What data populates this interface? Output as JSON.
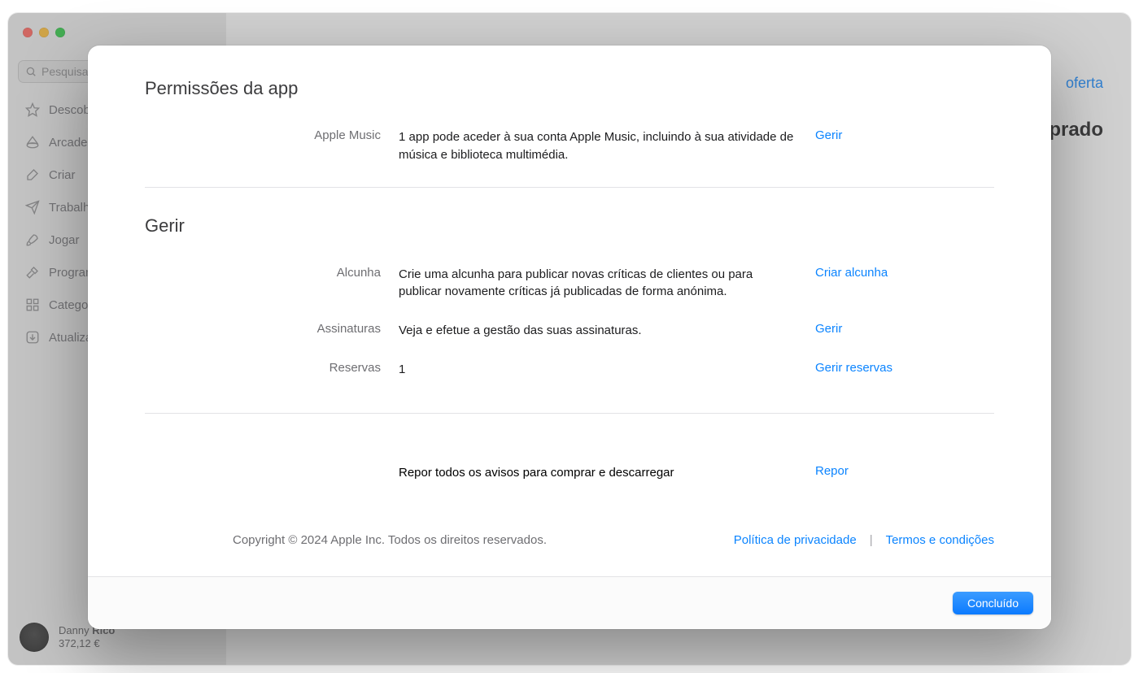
{
  "sidebar": {
    "search_placeholder": "Pesquisa",
    "items": [
      {
        "label": "Descobrir"
      },
      {
        "label": "Arcade"
      },
      {
        "label": "Criar"
      },
      {
        "label": "Trabalhar"
      },
      {
        "label": "Jogar"
      },
      {
        "label": "Programar"
      },
      {
        "label": "Categorias"
      },
      {
        "label": "Atualizações"
      }
    ],
    "user": {
      "first": "Danny",
      "last": "Rico",
      "balance": "372,12 €"
    }
  },
  "main_bg": {
    "offer": "oferta",
    "subword": "prado"
  },
  "modal": {
    "section_permissions": "Permissões da app",
    "apple_music": {
      "label": "Apple Music",
      "desc": "1 app pode aceder à sua conta Apple Music, incluindo à sua atividade de música e biblioteca multimédia.",
      "action": "Gerir"
    },
    "section_manage": "Gerir",
    "nickname": {
      "label": "Alcunha",
      "desc": "Crie uma alcunha para publicar novas críticas de clientes ou para publicar novamente críticas já publicadas de forma anónima.",
      "action": "Criar alcunha"
    },
    "subscriptions": {
      "label": "Assinaturas",
      "desc": "Veja e efetue a gestão das suas assinaturas.",
      "action": "Gerir"
    },
    "preorders": {
      "label": "Reservas",
      "desc": "1",
      "action": "Gerir reservas"
    },
    "reset": {
      "desc": "Repor todos os avisos para comprar e descarregar",
      "action": "Repor"
    },
    "footer": {
      "copyright": "Copyright © 2024 Apple Inc. Todos os direitos reservados.",
      "privacy": "Política de privacidade",
      "terms": "Termos e condições",
      "sep": "|"
    },
    "done": "Concluído"
  }
}
